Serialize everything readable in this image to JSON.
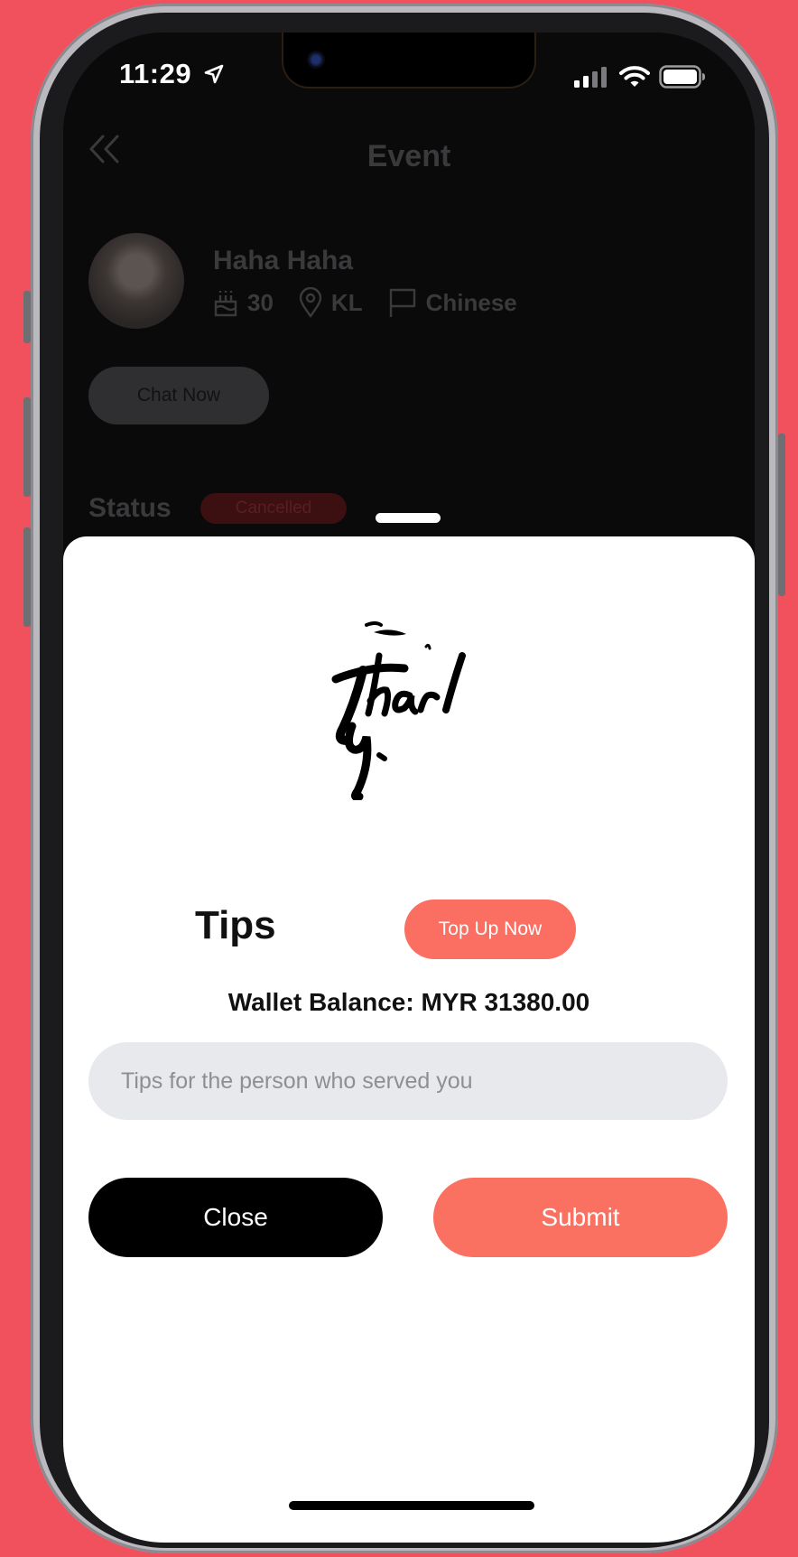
{
  "status_bar": {
    "time": "11:29"
  },
  "nav": {
    "title": "Event"
  },
  "profile": {
    "name": "Haha Haha",
    "age": "30",
    "location": "KL",
    "language": "Chinese"
  },
  "chat_button": "Chat Now",
  "status": {
    "label": "Status",
    "value": "Cancelled"
  },
  "sheet": {
    "title": "Tips",
    "top_up_label": "Top Up Now",
    "wallet_balance": "Wallet Balance: MYR 31380.00",
    "tip_input_placeholder": "Tips for the person who served you",
    "close_label": "Close",
    "submit_label": "Submit"
  },
  "colors": {
    "accent": "#fa6f62",
    "background": "#f1505d",
    "sheet": "#ffffff"
  }
}
